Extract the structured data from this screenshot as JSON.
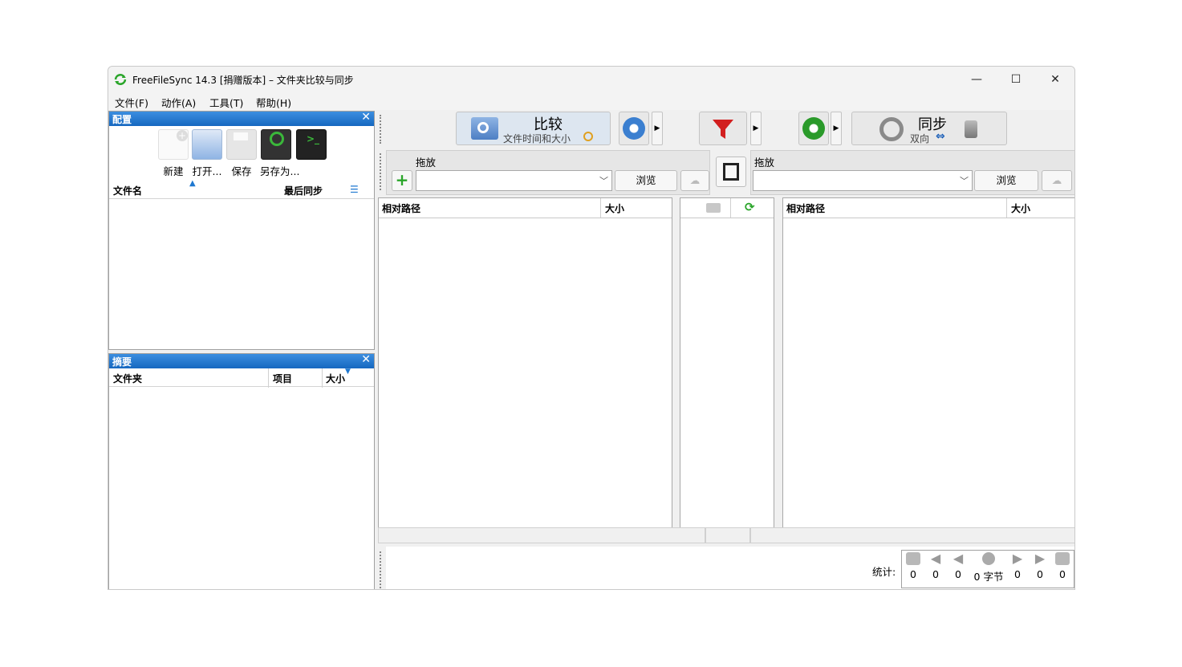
{
  "window": {
    "title": "FreeFileSync 14.3 [捐赠版本] – 文件夹比较与同步",
    "minimize": "—",
    "maximize": "☐",
    "close": "✕"
  },
  "menu": [
    "文件(F)",
    "动作(A)",
    "工具(T)",
    "帮助(H)"
  ],
  "config_panel": {
    "title": "配置",
    "close": "✕",
    "tools": [
      {
        "label": "新建",
        "icon": "new-config-icon"
      },
      {
        "label": "打开...",
        "icon": "open-config-icon"
      },
      {
        "label": "保存",
        "icon": "save-icon"
      },
      {
        "label": "另存为...",
        "icon": "save-as-icon"
      }
    ],
    "columns": {
      "name": "文件名",
      "last_sync": "最后同步"
    }
  },
  "summary_panel": {
    "title": "摘要",
    "close": "✕",
    "columns": {
      "folder": "文件夹",
      "items": "项目",
      "size": "大小"
    }
  },
  "toolbar": {
    "compare_title": "比较",
    "compare_sub": "文件时间和大小",
    "sync_title": "同步",
    "sync_sub": "双向"
  },
  "left_folder": {
    "label": "拖放",
    "value": "",
    "browse": "浏览"
  },
  "right_folder": {
    "label": "拖放",
    "value": "",
    "browse": "浏览"
  },
  "left_grid": {
    "path": "相对路径",
    "size": "大小"
  },
  "right_grid": {
    "path": "相对路径",
    "size": "大小"
  },
  "stats": {
    "label": "统计:",
    "values": [
      "0",
      "0",
      "0",
      "0 字节",
      "0",
      "0",
      "0"
    ]
  },
  "colors": {
    "accent": "#1f78d0",
    "window_bg": "#f0f0f0"
  }
}
